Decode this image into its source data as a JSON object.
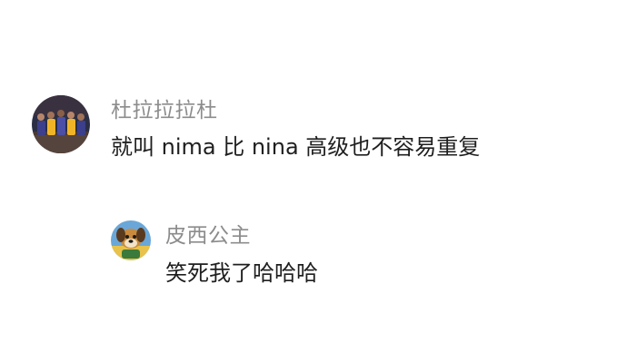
{
  "comments": [
    {
      "username": "杜拉拉拉杜",
      "text": "就叫 nima 比 nina 高级也不容易重复",
      "avatar": "team-photo-avatar"
    }
  ],
  "replies": [
    {
      "username": "皮西公主",
      "text": "笑死我了哈哈哈",
      "avatar": "cartoon-dog-avatar"
    }
  ]
}
